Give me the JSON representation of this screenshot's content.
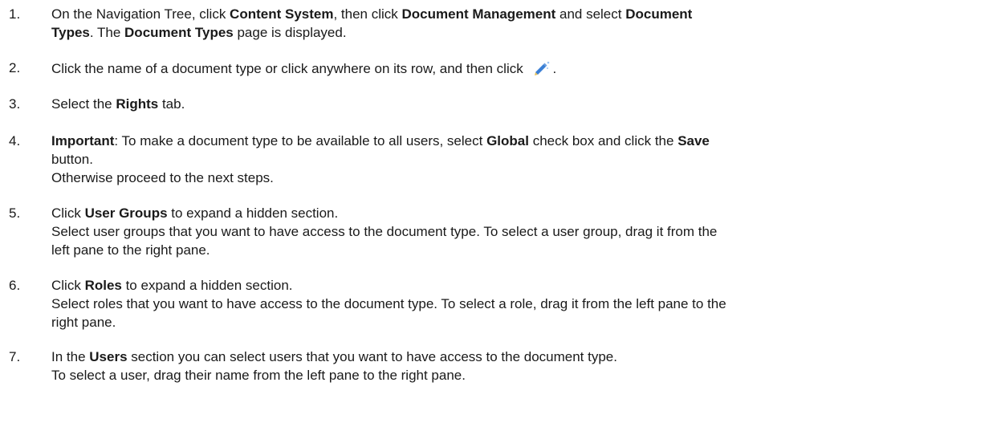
{
  "steps": [
    {
      "number": "1.",
      "lines": [
        [
          {
            "t": "On the Navigation Tree, click "
          },
          {
            "t": "Content System",
            "b": true
          },
          {
            "t": ", then click "
          },
          {
            "t": "Document Management",
            "b": true
          },
          {
            "t": " and select "
          },
          {
            "t": "Document",
            "b": true
          }
        ],
        [
          {
            "t": "Types",
            "b": true
          },
          {
            "t": ". The "
          },
          {
            "t": "Document Types",
            "b": true
          },
          {
            "t": " page is displayed."
          }
        ]
      ]
    },
    {
      "number": "2.",
      "lines": [
        [
          {
            "t": "Click the name of a document type or click anywhere on its row, and then click "
          },
          {
            "icon": "edit-pencil-icon"
          },
          {
            "t": "."
          }
        ]
      ]
    },
    {
      "number": "3.",
      "lines": [
        [
          {
            "t": "Select the "
          },
          {
            "t": "Rights",
            "b": true
          },
          {
            "t": " tab."
          }
        ]
      ]
    },
    {
      "number": "4.",
      "lines": [
        [
          {
            "t": "Important",
            "b": true
          },
          {
            "t": ": To make a document type to be available to all users, select "
          },
          {
            "t": "Global",
            "b": true
          },
          {
            "t": " check box and click the "
          },
          {
            "t": "Save",
            "b": true
          }
        ],
        [
          {
            "t": "button."
          }
        ],
        [
          {
            "t": "Otherwise proceed to the next steps."
          }
        ]
      ]
    },
    {
      "number": "5.",
      "lines": [
        [
          {
            "t": "Click "
          },
          {
            "t": "User Groups",
            "b": true
          },
          {
            "t": " to expand a hidden section."
          }
        ],
        [
          {
            "t": "Select user groups that you want to have access to the document type. To select a user group, drag it from the"
          }
        ],
        [
          {
            "t": "left pane to the right pane."
          }
        ]
      ]
    },
    {
      "number": "6.",
      "lines": [
        [
          {
            "t": "Click "
          },
          {
            "t": "Roles",
            "b": true
          },
          {
            "t": " to expand a hidden section."
          }
        ],
        [
          {
            "t": "Select roles that you want to have access to the document type. To select a role, drag it from the left pane to the"
          }
        ],
        [
          {
            "t": "right pane."
          }
        ]
      ]
    },
    {
      "number": "7.",
      "lines": [
        [
          {
            "t": "In the "
          },
          {
            "t": "Users",
            "b": true
          },
          {
            "t": " section you can select users that you want to have access to the document type."
          }
        ],
        [
          {
            "t": "To select a user, drag their name from the left pane to the right pane."
          }
        ]
      ]
    }
  ],
  "icon_colors": {
    "pencil_body": "#3a7fd5",
    "pencil_tip": "#e8c15a",
    "sparkle": "#9cc3f0"
  }
}
